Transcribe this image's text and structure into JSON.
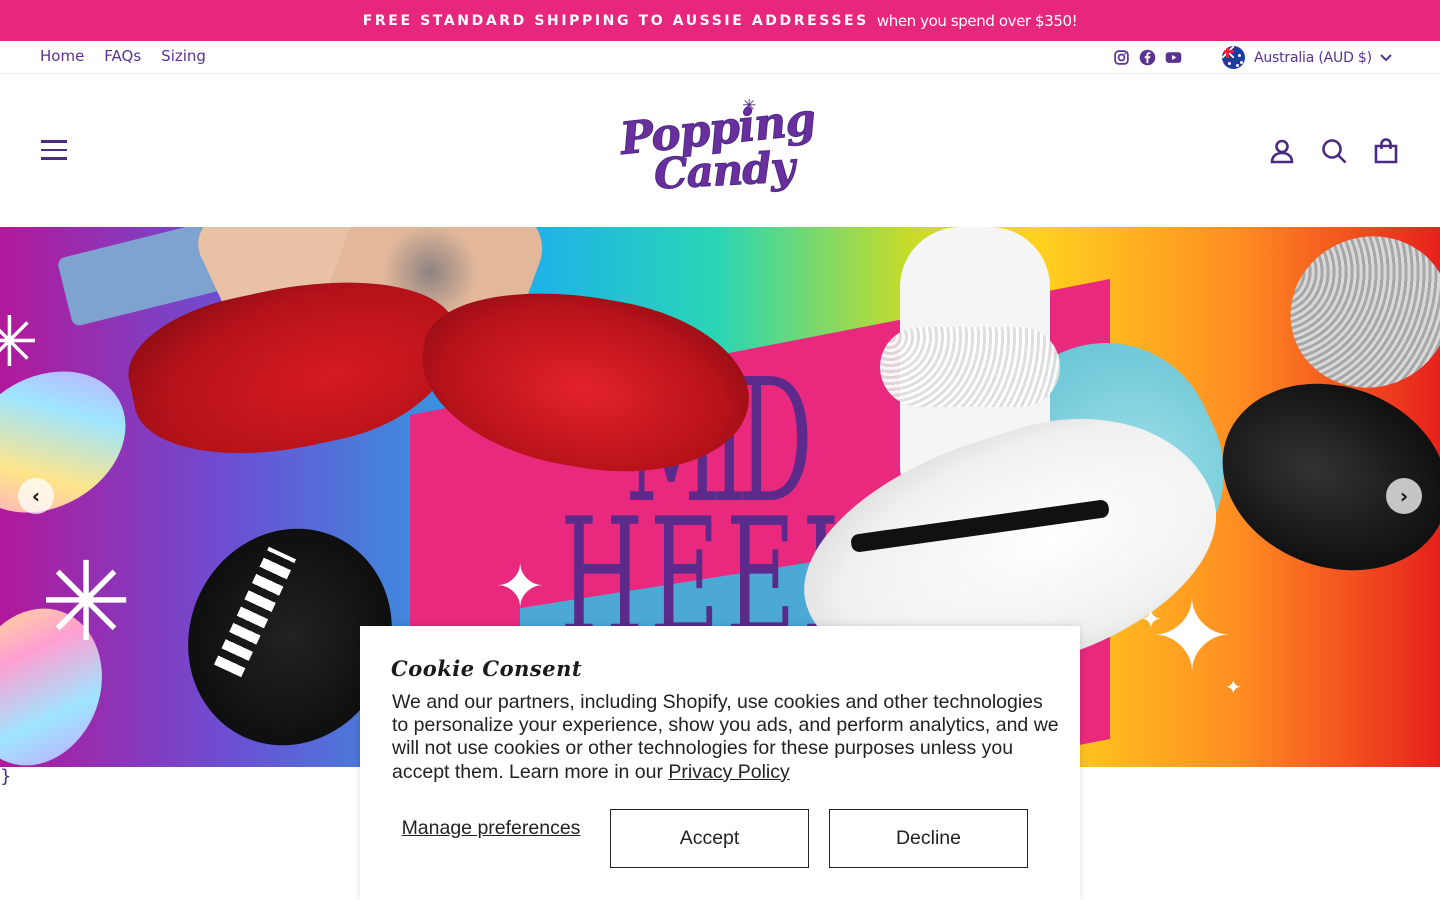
{
  "announcement": {
    "bold_text": "FREE STANDARD SHIPPING TO AUSSIE ADDRESSES",
    "thin_text": "when you spend over $350!",
    "bg_color": "#e7267d"
  },
  "utility_nav": {
    "links": [
      "Home",
      "FAQs",
      "Sizing"
    ],
    "social_icons": [
      "instagram-icon",
      "facebook-icon",
      "youtube-icon"
    ],
    "locale": "Australia (AUD $)"
  },
  "header": {
    "logo_line1": "Popping",
    "logo_line2": "Candy",
    "icons": [
      "menu-icon",
      "account-icon",
      "search-icon",
      "cart-icon"
    ],
    "brand_color": "#4b2a82"
  },
  "hero": {
    "banner_text_top": "MID",
    "banner_text_bottom": "HEELS",
    "arrow_left": "‹",
    "arrow_right": "›"
  },
  "stray_text": "}",
  "cookie_banner": {
    "title": "Cookie Consent",
    "body": "We and our partners, including Shopify, use cookies and other technologies to personalize your experience, show you ads, and perform analytics, and we will not use cookies or other technologies for these purposes unless you accept them. Learn more in our ",
    "link_text": "Privacy Policy",
    "manage_label": "Manage preferences",
    "accept_label": "Accept",
    "decline_label": "Decline"
  }
}
